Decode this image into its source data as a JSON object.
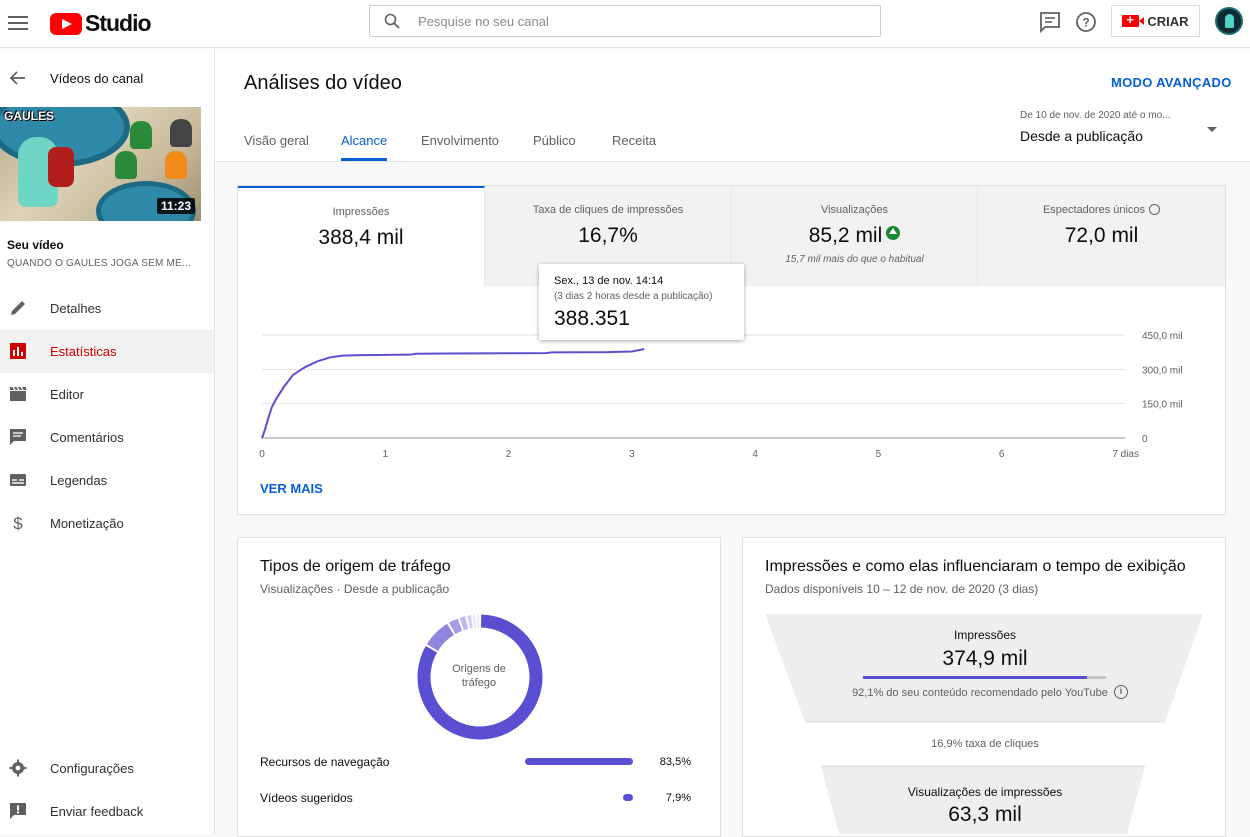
{
  "app": {
    "logo_text": "Studio"
  },
  "search": {
    "placeholder": "Pesquise no seu canal"
  },
  "topbar": {
    "create_label": "CRIAR"
  },
  "sidebar": {
    "back_label": "Vídeos do canal",
    "thumbnail_title": "GAULES",
    "duration": "11:23",
    "your_video": "Seu vídeo",
    "video_title": "QUANDO O GAULES JOGA SEM ME...",
    "items": [
      {
        "label": "Detalhes",
        "icon": "pencil-icon"
      },
      {
        "label": "Estatísticas",
        "icon": "analytics-icon",
        "active": true
      },
      {
        "label": "Editor",
        "icon": "clapperboard-icon"
      },
      {
        "label": "Comentários",
        "icon": "comment-icon"
      },
      {
        "label": "Legendas",
        "icon": "subtitles-icon"
      },
      {
        "label": "Monetização",
        "icon": "dollar-icon"
      }
    ],
    "bottom_items": [
      {
        "label": "Configurações",
        "icon": "gear-icon"
      },
      {
        "label": "Enviar feedback",
        "icon": "feedback-icon"
      }
    ]
  },
  "header": {
    "title": "Análises do vídeo",
    "advanced_mode": "MODO AVANÇADO",
    "tabs": [
      "Visão geral",
      "Alcance",
      "Envolvimento",
      "Público",
      "Receita"
    ],
    "active_tab": "Alcance",
    "date_range_small": "De 10 de nov. de 2020 até o mo...",
    "date_range": "Desde a publicação"
  },
  "metrics": [
    {
      "label": "Impressões",
      "value": "388,4 mil"
    },
    {
      "label": "Taxa de cliques de impressões",
      "value": "16,7%"
    },
    {
      "label": "Visualizações",
      "value": "85,2 mil",
      "sub": "15,7 mil mais do que o habitual",
      "trend": "up"
    },
    {
      "label": "Espectadores únicos",
      "value": "72,0 mil"
    }
  ],
  "tooltip": {
    "date": "Sex., 13 de nov. 14:14",
    "detail": "(3 dias 2 horas desde a publicação)",
    "value": "388.351"
  },
  "see_more": "VER MAIS",
  "chart_data": {
    "type": "line",
    "x_ticks": [
      "0",
      "1",
      "2",
      "3",
      "4",
      "5",
      "6",
      "7 dias"
    ],
    "y_ticks": [
      "0",
      "150,0 mil",
      "300,0 mil",
      "450,0 mil"
    ],
    "ylim": [
      0,
      450000
    ],
    "xlim": [
      0,
      7
    ],
    "color": "#5b4fd1",
    "x": [
      0,
      0.02,
      0.05,
      0.08,
      0.12,
      0.18,
      0.25,
      0.35,
      0.45,
      0.55,
      0.65,
      0.8,
      1.0,
      1.2,
      1.25,
      1.5,
      2.0,
      2.3,
      2.35,
      2.8,
      3.0,
      3.1
    ],
    "y": [
      0,
      30000,
      85000,
      135000,
      175000,
      225000,
      275000,
      310000,
      335000,
      352000,
      360000,
      362000,
      363000,
      364000,
      368000,
      369000,
      370000,
      371000,
      374000,
      375000,
      378000,
      388351
    ]
  },
  "traffic": {
    "title": "Tipos de origem de tráfego",
    "subtitle": "Visualizações · Desde a publicação",
    "donut_label": "Origens de tráfego",
    "donut": [
      83.5,
      7.9,
      3.0,
      2.0,
      1.5,
      1.0,
      1.1
    ],
    "rows": [
      {
        "label": "Recursos de navegação",
        "pct": "83,5%",
        "value": 83.5
      },
      {
        "label": "Vídeos sugeridos",
        "pct": "7,9%",
        "value": 7.9
      }
    ]
  },
  "funnel": {
    "title": "Impressões e como elas influenciaram o tempo de exibição",
    "subtitle": "Dados disponíveis 10 – 12 de nov. de 2020 (3 dias)",
    "impressions_label": "Impressões",
    "impressions_value": "374,9 mil",
    "recommended_pct": 92.1,
    "recommended_text": "92,1% do seu conteúdo recomendado pelo YouTube",
    "ctr_text": "16,9% taxa de cliques",
    "views_label": "Visualizações de impressões",
    "views_value": "63,3 mil"
  }
}
